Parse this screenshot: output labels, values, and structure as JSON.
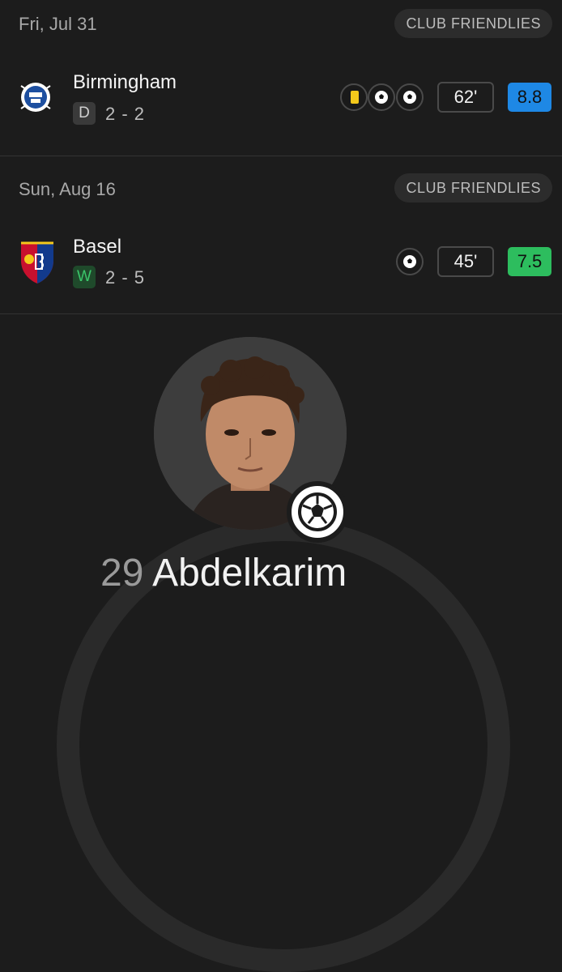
{
  "matches": [
    {
      "date": "Fri, Jul 31",
      "competition": "CLUB FRIENDLIES",
      "opponent": "Birmingham",
      "result": "D",
      "score": "2 - 2",
      "events": [
        "yellow-card-icon",
        "soccer-ball-icon",
        "soccer-ball-icon"
      ],
      "minutes": "62'",
      "rating": "8.8",
      "rating_color": "#1e88e5"
    },
    {
      "date": "Sun, Aug 16",
      "competition": "CLUB FRIENDLIES",
      "opponent": "Basel",
      "result": "W",
      "score": "2 - 5",
      "events": [
        "soccer-ball-icon"
      ],
      "minutes": "45'",
      "rating": "7.5",
      "rating_color": "#2dbd5e"
    }
  ],
  "player": {
    "number": "29",
    "name": "Abdelkarim"
  },
  "colors": {
    "background": "#1c1c1c",
    "yellow_card": "#f4c91b",
    "win": "#3bc56a"
  }
}
